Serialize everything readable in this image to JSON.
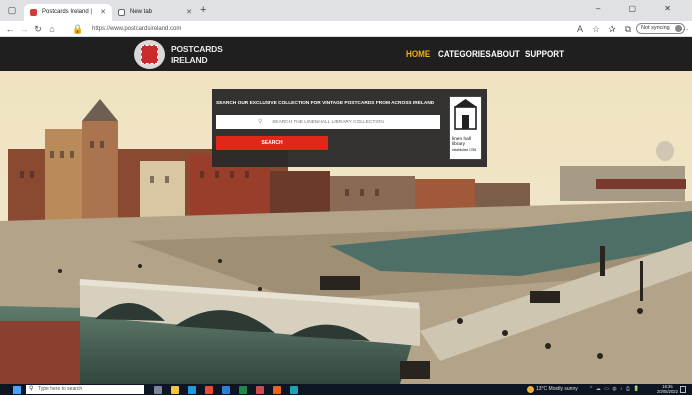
{
  "browser": {
    "tabs": [
      {
        "title": "Postcards Ireland |",
        "favicon_color": "#d23b3b",
        "active": true
      },
      {
        "title": "New tab",
        "favicon_color": "#ffffff",
        "active": false
      }
    ],
    "new_tab_symbol": "+",
    "close_symbol": "✕",
    "window_controls": "–  ▢  ✕",
    "url": "https://www.postcardsireland.com",
    "sync_label": "Not syncing",
    "more_symbol": "···"
  },
  "site": {
    "logo_line1": "POSTCARDS",
    "logo_line2": "IRELAND",
    "nav": [
      {
        "label": "HOME",
        "active": true
      },
      {
        "label": "CATEGORIES",
        "active": false
      },
      {
        "label": "ABOUT",
        "active": false
      },
      {
        "label": "SUPPORT",
        "active": false
      }
    ]
  },
  "hero": {
    "panel_title": "SEARCH OUR EXCLUSIVE COLLECTION FOR VINTAGE POSTCARDS FROM ACROSS IRELAND",
    "search_placeholder": "SEARCH THE LINENHALL LIBRARY COLLECTION",
    "search_button": "SEARCH",
    "library_lines": [
      "linen hall",
      "library",
      "established 1788"
    ]
  },
  "taskbar": {
    "search_placeholder": "Type here to search",
    "weather": "13°C  Mostly sunny",
    "time": "16:35",
    "date": "20/05/2022",
    "apps": [
      {
        "name": "task-view-app",
        "color": "#7a8599"
      },
      {
        "name": "file-explorer-app",
        "color": "#f4c542"
      },
      {
        "name": "edge-app",
        "color": "#1f9bde"
      },
      {
        "name": "chrome-app",
        "color": "#e94b35"
      },
      {
        "name": "store-app",
        "color": "#2f7fd8"
      },
      {
        "name": "excel-app",
        "color": "#1e8a49"
      },
      {
        "name": "photos-app",
        "color": "#d04c4c"
      },
      {
        "name": "firefox-app",
        "color": "#e8661c"
      },
      {
        "name": "edge-active-app",
        "color": "#1ba1b0"
      }
    ]
  },
  "colors": {
    "header_bg": "#1f1f1f",
    "nav_active": "#f0b214",
    "search_button_bg": "#e02818",
    "panel_bg": "#2b2b2b"
  }
}
